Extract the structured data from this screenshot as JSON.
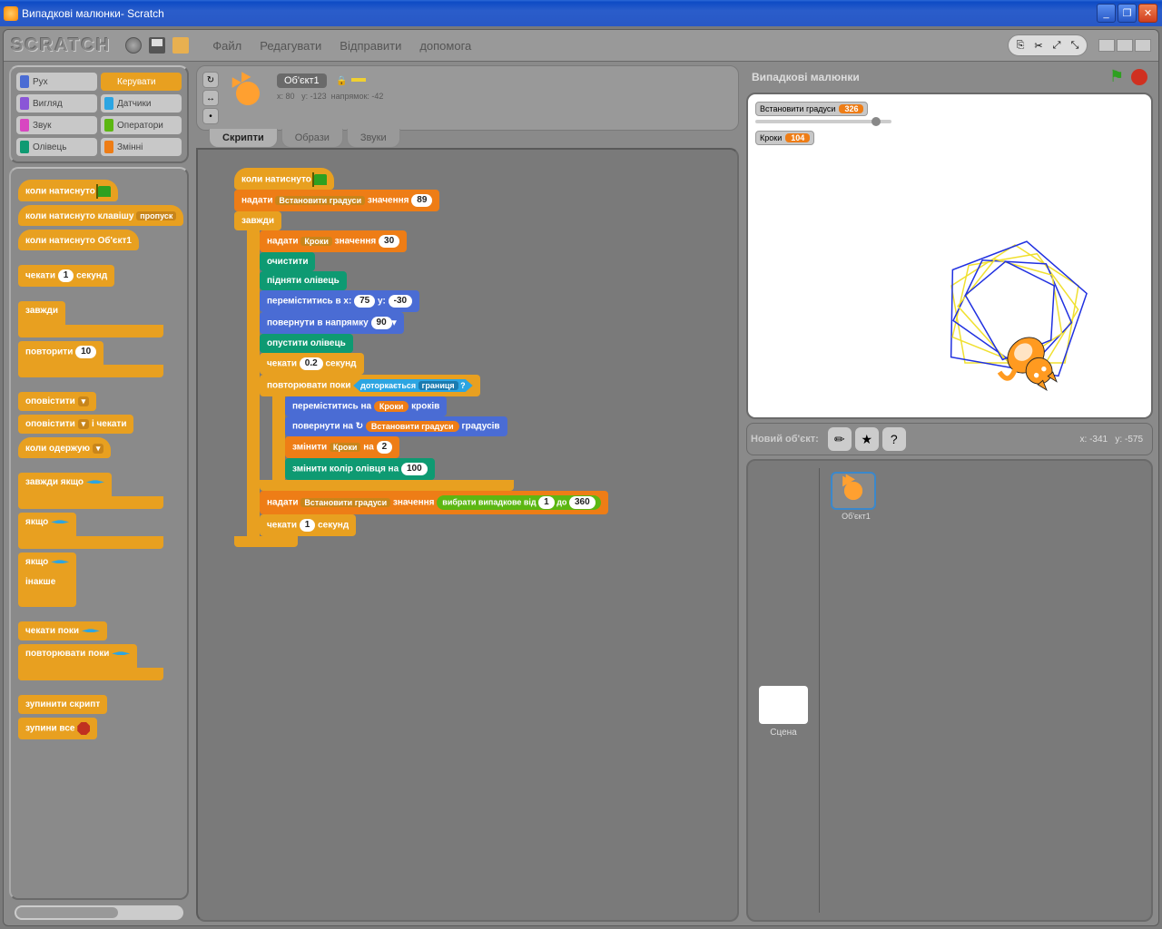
{
  "window": {
    "title": "Випадкові малюнки- Scratch"
  },
  "menu": {
    "file": "Файл",
    "edit": "Редагувати",
    "share": "Відправити",
    "help": "допомога"
  },
  "categories": [
    {
      "label": "Рух",
      "color": "#4a6cd4"
    },
    {
      "label": "Керувати",
      "color": "#e8a020",
      "active": true
    },
    {
      "label": "Вигляд",
      "color": "#8a55d7"
    },
    {
      "label": "Датчики",
      "color": "#2ca5e2"
    },
    {
      "label": "Звук",
      "color": "#d846c1"
    },
    {
      "label": "Оператори",
      "color": "#5cb712"
    },
    {
      "label": "Олівець",
      "color": "#0e9a72"
    },
    {
      "label": "Змінні",
      "color": "#ee7d16"
    }
  ],
  "palette": {
    "when_flag": "коли натиснуто",
    "when_key": "коли натиснуто клавішу",
    "when_key_opt": "пропуск",
    "when_sprite": "коли натиснуто  Об'єкт1",
    "wait": "чекати",
    "wait_val": "1",
    "wait_unit": "секунд",
    "forever": "завжди",
    "repeat": "повторити",
    "repeat_val": "10",
    "broadcast": "оповістити",
    "broadcast_wait": "оповістити",
    "broadcast_wait2": "і чекати",
    "when_receive": "коли одержую",
    "forever_if": "завжди якщо",
    "if": "якщо",
    "if_else1": "якщо",
    "else": "інакше",
    "wait_until": "чекати поки",
    "repeat_until": "повторювати поки",
    "stop_script": "зупинити скрипт",
    "stop_all": "зупини все"
  },
  "sprite": {
    "name": "Об'єкт1",
    "x_label": "x:",
    "x": "80",
    "y_label": "y:",
    "y": "-123",
    "dir_label": "напрямок:",
    "dir": "-42"
  },
  "tabs": {
    "scripts": "Скрипти",
    "costumes": "Образи",
    "sounds": "Звуки"
  },
  "script": {
    "when_flag": "коли натиснуто",
    "set1": "надати",
    "set1_var": "Встановити  градуси",
    "set1_mid": "значення",
    "set1_val": "89",
    "forever": "завжди",
    "set2": "надати",
    "set2_var": "Кроки",
    "set2_mid": "значення",
    "set2_val": "30",
    "clear": "очистити",
    "pen_up": "підняти олівець",
    "goto": "переміститись в x:",
    "goto_x": "75",
    "goto_ymid": "y:",
    "goto_y": "-30",
    "point": "повернути в напрямку",
    "point_val": "90",
    "pen_down": "опустити олівець",
    "wait02": "чекати",
    "wait02_val": "0.2",
    "wait02_unit": "секунд",
    "repeat_until": "повторювати поки",
    "touching": "доторкається",
    "touching_opt": "границя",
    "q": "?",
    "move": "переміститись на",
    "move_var": "Кроки",
    "move_unit": "кроків",
    "turn": "повернути на",
    "turn_var": "Встановити  градуси",
    "turn_unit": "градусів",
    "change": "змінити",
    "change_var": "Кроки",
    "change_mid": "на",
    "change_val": "2",
    "pen_color": "змінити колір олівця на",
    "pen_color_val": "100",
    "set3": "надати",
    "set3_var": "Встановити  градуси",
    "set3_mid": "значення",
    "random": "вибрати випадкове від",
    "random_a": "1",
    "random_to": "до",
    "random_b": "360",
    "wait1": "чекати",
    "wait1_val": "1",
    "wait1_unit": "секунд"
  },
  "stage": {
    "title": "Випадкові малюнки",
    "monitor1_label": "Встановити градуси",
    "monitor1_val": "326",
    "monitor2_label": "Кроки",
    "monitor2_val": "104"
  },
  "spritebar": {
    "label": "Новий об'єкт:",
    "mouse_x_label": "x:",
    "mouse_x": "-341",
    "mouse_y_label": "y:",
    "mouse_y": "-575"
  },
  "spritelist": {
    "scene": "Сцена",
    "sprite1": "Об'єкт1"
  }
}
